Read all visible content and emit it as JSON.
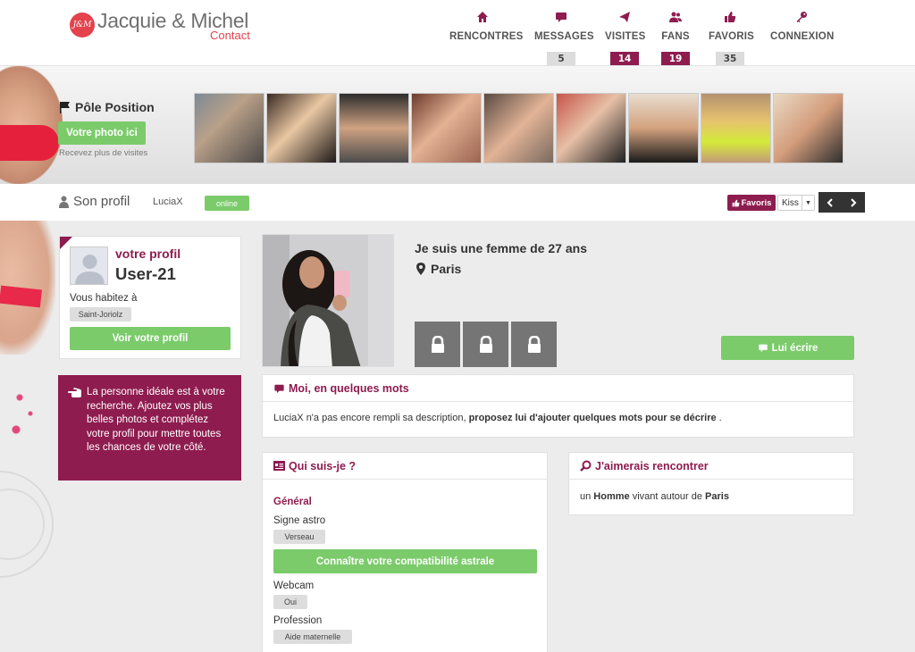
{
  "logo": {
    "badge": "J&M",
    "title": "Jacquie & Michel",
    "subtitle": "Contact"
  },
  "nav": [
    {
      "label": "RENCONTRES",
      "icon": "home-icon",
      "count": ""
    },
    {
      "label": "MESSAGES",
      "icon": "chat-icon",
      "count": "5"
    },
    {
      "label": "VISITES",
      "icon": "paper-plane-icon",
      "count": "14"
    },
    {
      "label": "FANS",
      "icon": "users-icon",
      "count": "19"
    },
    {
      "label": "FAVORIS",
      "icon": "thumbs-up-icon",
      "count": "35"
    },
    {
      "label": "CONNEXION",
      "icon": "key-icon",
      "count": ""
    }
  ],
  "colors": {
    "brand": "#8e1c4f",
    "green": "#7bcb6b",
    "logo_red": "#e4424d",
    "count_dark": "#8e1c4f",
    "count_light": "#dcdcdc"
  },
  "pole": {
    "title": "Pôle Position",
    "button": "Votre photo ici",
    "subtitle": "Recevez plus de visites"
  },
  "profile_bar": {
    "title": "Son profil",
    "username": "LuciaX",
    "status": "online",
    "favoris": "Favoris",
    "kiss": "Kiss"
  },
  "me": {
    "title": "votre profil",
    "user": "User-21",
    "live_label": "Vous habitez à",
    "city": "Saint-Joriolz",
    "button": "Voir votre profil"
  },
  "tip": {
    "text": "La personne idéale est à votre recherche. Ajoutez vos plus belles photos et complétez votre profil pour mettre toutes les chances de votre côté."
  },
  "profile": {
    "headline": "Je suis une femme de 27 ans",
    "city": "Paris",
    "write_button": "Lui écrire"
  },
  "about": {
    "title": "Moi, en quelques mots",
    "text_start": "LuciaX n'a pas encore rempli sa description, ",
    "text_bold": "proposez lui d'ajouter quelques mots pour se décrire",
    "text_end": " ."
  },
  "who": {
    "title": "Qui suis-je ?",
    "section": "Général",
    "astro_label": "Signe astro",
    "astro_value": "Verseau",
    "astro_button": "Connaître votre compatibilité astrale",
    "webcam_label": "Webcam",
    "webcam_value": "Oui",
    "job_label": "Profession",
    "job_value": "Aide maternelle"
  },
  "looking": {
    "title": "J'aimerais rencontrer",
    "prefix": "un ",
    "who": "Homme",
    "middle": " vivant autour de ",
    "where": "Paris"
  }
}
